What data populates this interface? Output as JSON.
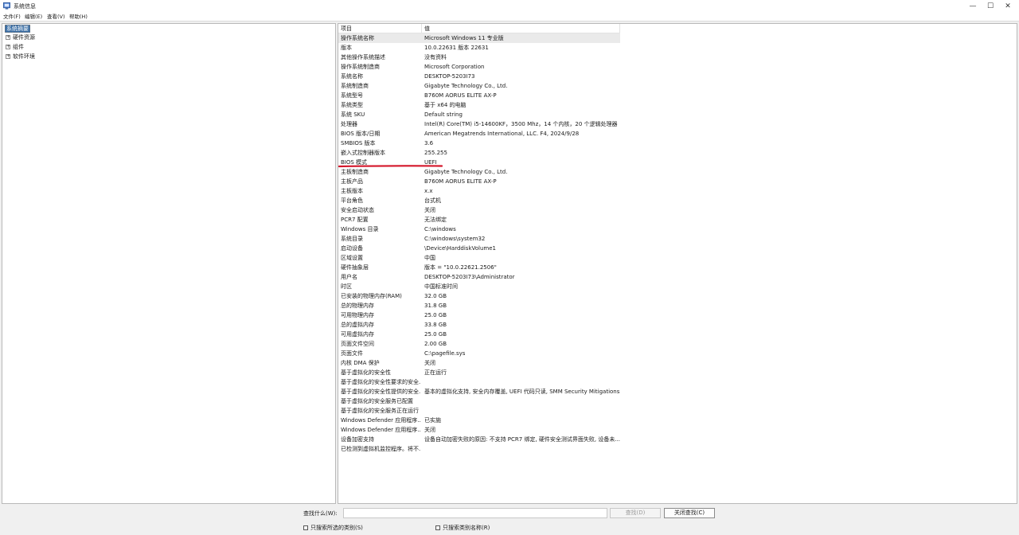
{
  "window": {
    "title": "系统信息",
    "icon": "system-information-icon",
    "controls": {
      "minimize": "—",
      "maximize": "☐",
      "close": "✕"
    }
  },
  "menu": [
    "文件(F)",
    "编辑(E)",
    "查看(V)",
    "帮助(H)"
  ],
  "tree": {
    "root": "系统摘要",
    "children": [
      {
        "label": "硬件资源",
        "expander": "+"
      },
      {
        "label": "组件",
        "expander": "+"
      },
      {
        "label": "软件环境",
        "expander": "+"
      }
    ]
  },
  "list": {
    "columns": [
      "项目",
      "值"
    ],
    "rows": [
      [
        "操作系统名称",
        "Microsoft Windows 11 专业版"
      ],
      [
        "版本",
        "10.0.22631 版本 22631"
      ],
      [
        "其他操作系统描述",
        "没有资料"
      ],
      [
        "操作系统制造商",
        "Microsoft Corporation"
      ],
      [
        "系统名称",
        "DESKTOP-5203I73"
      ],
      [
        "系统制造商",
        "Gigabyte Technology Co., Ltd."
      ],
      [
        "系统型号",
        "B760M AORUS ELITE AX-P"
      ],
      [
        "系统类型",
        "基于 x64 的电脑"
      ],
      [
        "系统 SKU",
        "Default string"
      ],
      [
        "处理器",
        "Intel(R) Core(TM) i5-14600KF，3500 Mhz，14 个内核，20 个逻辑处理器"
      ],
      [
        "BIOS 版本/日期",
        "American Megatrends International, LLC. F4, 2024/9/28"
      ],
      [
        "SMBIOS 版本",
        "3.6"
      ],
      [
        "嵌入式控制器版本",
        "255.255"
      ],
      [
        "BIOS 模式",
        "UEFI"
      ],
      [
        "主板制造商",
        "Gigabyte Technology Co., Ltd."
      ],
      [
        "主板产品",
        "B760M AORUS ELITE AX-P"
      ],
      [
        "主板版本",
        "x.x"
      ],
      [
        "平台角色",
        "台式机"
      ],
      [
        "安全启动状态",
        "关闭"
      ],
      [
        "PCR7 配置",
        "无法绑定"
      ],
      [
        "Windows 目录",
        "C:\\windows"
      ],
      [
        "系统目录",
        "C:\\windows\\system32"
      ],
      [
        "启动设备",
        "\\Device\\HarddiskVolume1"
      ],
      [
        "区域设置",
        "中国"
      ],
      [
        "硬件抽象层",
        "版本 = \"10.0.22621.2506\""
      ],
      [
        "用户名",
        "DESKTOP-5203I73\\Administrator"
      ],
      [
        "时区",
        "中国标准时间"
      ],
      [
        "已安装的物理内存(RAM)",
        "32.0 GB"
      ],
      [
        "总的物理内存",
        "31.8 GB"
      ],
      [
        "可用物理内存",
        "25.0 GB"
      ],
      [
        "总的虚拟内存",
        "33.8 GB"
      ],
      [
        "可用虚拟内存",
        "25.0 GB"
      ],
      [
        "页面文件空间",
        "2.00 GB"
      ],
      [
        "页面文件",
        "C:\\pagefile.sys"
      ],
      [
        "内核 DMA 保护",
        "关闭"
      ],
      [
        "基于虚拟化的安全性",
        "正在运行"
      ],
      [
        "基于虚拟化的安全性要求的安全...",
        ""
      ],
      [
        "基于虚拟化的安全性提供的安全...",
        "基本的虚拟化支持, 安全内存覆盖, UEFI 代码只读, SMM Security Mitigations ..."
      ],
      [
        "基于虚拟化的安全服务已配置",
        ""
      ],
      [
        "基于虚拟化的安全服务正在运行",
        ""
      ],
      [
        "Windows Defender 应用程序...",
        "已实施"
      ],
      [
        "Windows Defender 应用程序...",
        "关闭"
      ],
      [
        "设备加密支持",
        "设备自动加密失败的原因: 不支持 PCR7 绑定, 硬件安全测试界面失败, 设备未..."
      ],
      [
        "已检测到虚拟机监控程序。将不...",
        ""
      ]
    ]
  },
  "find": {
    "label": "查找什么(W):",
    "value": "",
    "find_button": "查找(D)",
    "close_find_button": "关闭查找(C)",
    "checkbox_selected_category": "只搜索所选的类别(S)",
    "checkbox_category_names": "只搜索类别名称(R)"
  },
  "annotation_color": "#d4162a",
  "selection_color": "#3a6ea5"
}
